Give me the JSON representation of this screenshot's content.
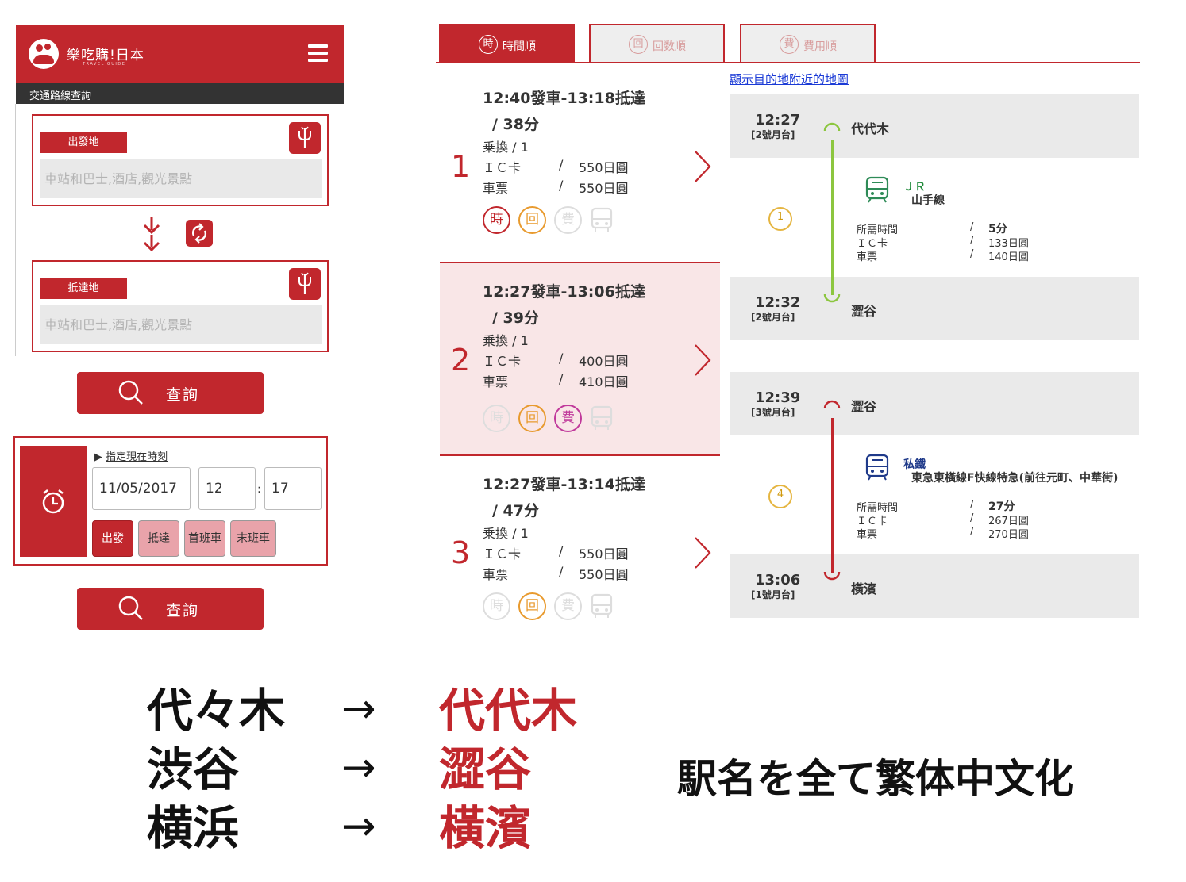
{
  "app": {
    "brand": "樂吃購!日本",
    "brand_sub": "TRAVEL GUIDE",
    "subbar": "交通路線查詢"
  },
  "search": {
    "from_label": "出發地",
    "to_label": "抵達地",
    "placeholder": "車站和巴士,酒店,觀光景點",
    "search_label": "查詢",
    "specify_time": "指定現在時刻",
    "date": "11/05/2017",
    "hour": "12",
    "minute": "17",
    "colon": ":",
    "modes": [
      "出發",
      "抵達",
      "首班車",
      "末班車"
    ],
    "selected_mode": "出發"
  },
  "tabs": [
    {
      "icon": "時",
      "label": "時間順",
      "active": true
    },
    {
      "icon": "回",
      "label": "回数順",
      "active": false
    },
    {
      "icon": "費",
      "label": "費用順",
      "active": false
    }
  ],
  "map_link": "顯示目的地附近的地圖",
  "routes": [
    {
      "num": "1",
      "time": "12:40發車-13:18抵達",
      "duration": "/ 38分",
      "transfer": "乗換 / 1",
      "ic_label": "ＩＣ卡",
      "ic_price": "550日圓",
      "ticket_label": "車票",
      "ticket_price": "550日圓",
      "sep": "/",
      "selected": false,
      "badges": {
        "fast": true,
        "few": true,
        "cheap": false
      }
    },
    {
      "num": "2",
      "time": "12:27發車-13:06抵達",
      "duration": "/ 39分",
      "transfer": "乗換 / 1",
      "ic_label": "ＩＣ卡",
      "ic_price": "400日圓",
      "ticket_label": "車票",
      "ticket_price": "410日圓",
      "sep": "/",
      "selected": true,
      "badges": {
        "fast": false,
        "few": true,
        "cheap": true
      }
    },
    {
      "num": "3",
      "time": "12:27發車-13:14抵達",
      "duration": "/ 47分",
      "transfer": "乗換 / 1",
      "ic_label": "ＩＣ卡",
      "ic_price": "550日圓",
      "ticket_label": "車票",
      "ticket_price": "550日圓",
      "sep": "/",
      "selected": false,
      "badges": {
        "fast": false,
        "few": true,
        "cheap": false
      }
    }
  ],
  "badge_glyphs": {
    "fast": "時",
    "few": "回",
    "cheap": "費"
  },
  "timeline": {
    "stops": [
      {
        "time": "12:27",
        "platform": "[2號月台]",
        "name": "代代木"
      },
      {
        "time": "12:32",
        "platform": "[2號月台]",
        "name": "澀谷"
      },
      {
        "time": "12:39",
        "platform": "[3號月台]",
        "name": "澀谷"
      },
      {
        "time": "13:06",
        "platform": "[1號月台]",
        "name": "橫濱"
      }
    ],
    "segments": [
      {
        "count": "1",
        "operator": "ＪＲ",
        "line": "山手線",
        "req_label": "所需時間",
        "req_val": "5分",
        "ic_label": "ＩＣ卡",
        "ic_val": "133日圓",
        "ticket_label": "車票",
        "ticket_val": "140日圓",
        "color": "#8cc63f",
        "op_color": "#1f8a3a"
      },
      {
        "count": "4",
        "operator": "私鐵",
        "line": "東急東橫線F快線特急(前往元町、中華街)",
        "req_label": "所需時間",
        "req_val": "27分",
        "ic_label": "ＩＣ卡",
        "ic_val": "267日圓",
        "ticket_label": "車票",
        "ticket_val": "270日圓",
        "color": "#c1272d",
        "op_color": "#1f3a8a"
      }
    ],
    "sep": "/"
  },
  "annotation": {
    "pairs": [
      {
        "jp": "代々木",
        "arrow": "→",
        "tw": "代代木"
      },
      {
        "jp": "渋谷",
        "arrow": "→",
        "tw": "澀谷"
      },
      {
        "jp": "横浜",
        "arrow": "→",
        "tw": "橫濱"
      }
    ],
    "note": "駅名を全て繁体中文化"
  },
  "colors": {
    "brand": "#c1272d",
    "jr": "#8cc63f",
    "private": "#c1272d",
    "fast": "#c1272d",
    "few": "#e89a2e",
    "cheap": "#c0399b",
    "muted": "#dddddd"
  }
}
